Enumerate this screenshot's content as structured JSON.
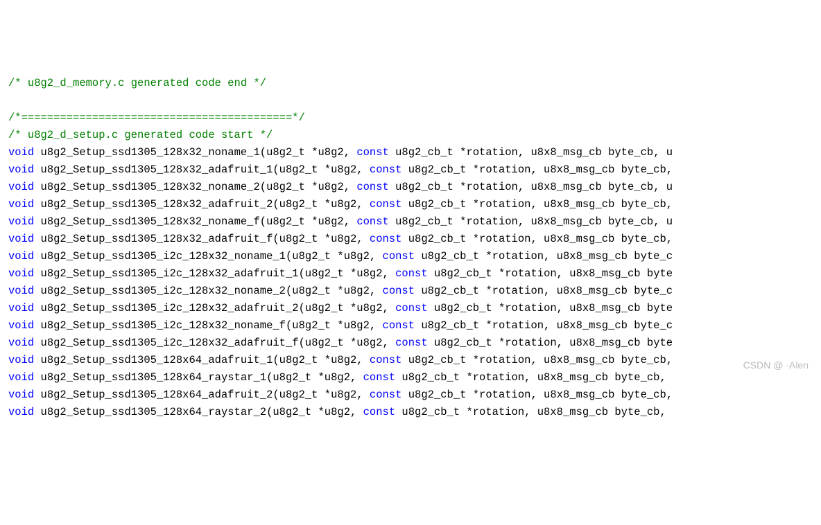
{
  "comments": {
    "memory_end": "/* u8g2_d_memory.c generated code end */",
    "divider": "/*==========================================*/",
    "setup_start": "/* u8g2_d_setup.c generated code start */"
  },
  "kw_void": "void",
  "kw_const": "const",
  "funcs": [
    {
      "name": "u8g2_Setup_ssd1305_128x32_noname_1",
      "tail": "u8x8_msg_cb byte_cb, u"
    },
    {
      "name": "u8g2_Setup_ssd1305_128x32_adafruit_1",
      "tail": "u8x8_msg_cb byte_cb,"
    },
    {
      "name": "u8g2_Setup_ssd1305_128x32_noname_2",
      "tail": "u8x8_msg_cb byte_cb, u"
    },
    {
      "name": "u8g2_Setup_ssd1305_128x32_adafruit_2",
      "tail": "u8x8_msg_cb byte_cb,"
    },
    {
      "name": "u8g2_Setup_ssd1305_128x32_noname_f",
      "tail": "u8x8_msg_cb byte_cb, u"
    },
    {
      "name": "u8g2_Setup_ssd1305_128x32_adafruit_f",
      "tail": "u8x8_msg_cb byte_cb,"
    },
    {
      "name": "u8g2_Setup_ssd1305_i2c_128x32_noname_1",
      "tail": "u8x8_msg_cb byte_c"
    },
    {
      "name": "u8g2_Setup_ssd1305_i2c_128x32_adafruit_1",
      "tail": "u8x8_msg_cb byte"
    },
    {
      "name": "u8g2_Setup_ssd1305_i2c_128x32_noname_2",
      "tail": "u8x8_msg_cb byte_c"
    },
    {
      "name": "u8g2_Setup_ssd1305_i2c_128x32_adafruit_2",
      "tail": "u8x8_msg_cb byte"
    },
    {
      "name": "u8g2_Setup_ssd1305_i2c_128x32_noname_f",
      "tail": "u8x8_msg_cb byte_c"
    },
    {
      "name": "u8g2_Setup_ssd1305_i2c_128x32_adafruit_f",
      "tail": "u8x8_msg_cb byte"
    },
    {
      "name": "u8g2_Setup_ssd1305_128x64_adafruit_1",
      "tail": "u8x8_msg_cb byte_cb,"
    },
    {
      "name": "u8g2_Setup_ssd1305_128x64_raystar_1",
      "tail": "u8x8_msg_cb byte_cb,"
    },
    {
      "name": "u8g2_Setup_ssd1305_128x64_adafruit_2",
      "tail": "u8x8_msg_cb byte_cb,"
    },
    {
      "name": "u8g2_Setup_ssd1305_128x64_raystar_2",
      "tail": "u8x8_msg_cb byte_cb,"
    }
  ],
  "sig": {
    "open": "(u8g2_t *u8g2, ",
    "mid": " u8g2_cb_t *rotation, "
  },
  "watermark": "CSDN @ ·Alen"
}
